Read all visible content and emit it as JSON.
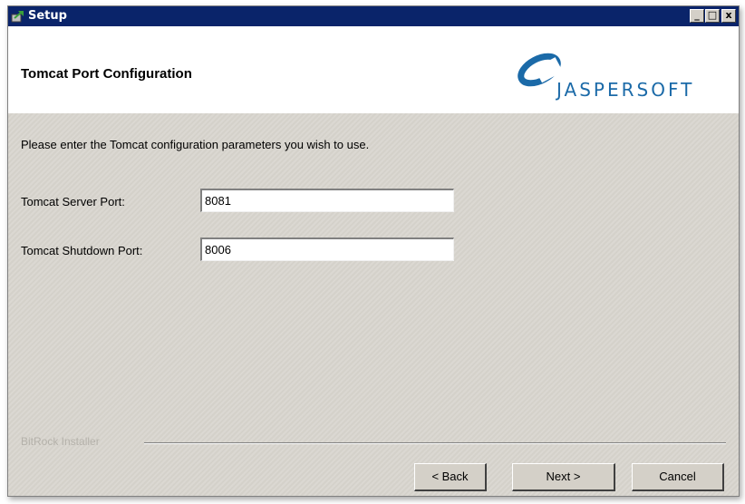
{
  "window": {
    "title": "Setup",
    "minimize_label": "_",
    "maximize_label": "□",
    "close_label": "x"
  },
  "header": {
    "page_title": "Tomcat Port Configuration",
    "logo_text": "JASPERSOFT"
  },
  "content": {
    "intro": "Please enter the Tomcat configuration parameters you wish to use.",
    "fields": [
      {
        "label": "Tomcat Server Port:",
        "value": "8081"
      },
      {
        "label": "Tomcat Shutdown Port:",
        "value": "8006"
      }
    ]
  },
  "footer": {
    "brand": "BitRock Installer",
    "back_label": "< Back",
    "next_label": "Next >",
    "cancel_label": "Cancel"
  },
  "colors": {
    "titlebar": "#0a246a",
    "dialog_bg": "#d4d0c8",
    "logo_blue": "#1b6aa8"
  }
}
